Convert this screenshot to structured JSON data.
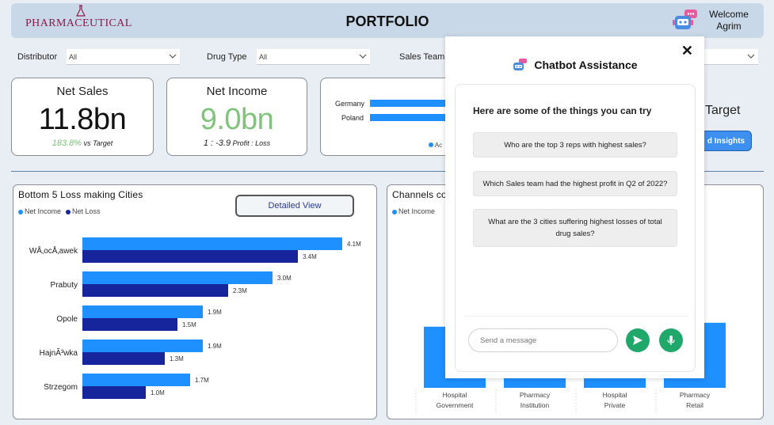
{
  "header": {
    "logo_text": "PHARMACEUTICAL",
    "title": "PORTFOLIO",
    "welcome": "Welcome",
    "user": "Agrim"
  },
  "filters": [
    {
      "label": "Distributor",
      "value": "All"
    },
    {
      "label": "Drug Type",
      "value": "All"
    },
    {
      "label": "Sales Team",
      "value": ""
    }
  ],
  "kpis": {
    "net_sales": {
      "title": "Net Sales",
      "value": "11.8bn",
      "delta": "183.8%",
      "delta_label": "vs Target"
    },
    "net_income": {
      "title": "Net Income",
      "value": "9.0bn",
      "ratio": "1 : -3.9",
      "ratio_label": "Profit : Loss"
    }
  },
  "country_chart": {
    "categories": [
      "Germany",
      "Poland"
    ],
    "legend_fragment": "Ac"
  },
  "target_fragment": "Target",
  "insights_button": "d Insights",
  "loss_cities": {
    "title": "Bottom 5 Loss making Cities",
    "legend": [
      "Net Income",
      "Net Loss"
    ],
    "detail_button": "Detailed View"
  },
  "channels": {
    "title_fragment": "Channels co",
    "legend_fragment": "Net Income",
    "categories": [
      {
        "l1": "Hospital",
        "l2": "Government"
      },
      {
        "l1": "Pharmacy",
        "l2": "Institution"
      },
      {
        "l1": "Hospital",
        "l2": "Private"
      },
      {
        "l1": "Pharmacy",
        "l2": "Retail"
      }
    ]
  },
  "chatbot": {
    "title": "Chatbot Assistance",
    "close": "✕",
    "hint": "Here are some of the things you can try",
    "suggestions": [
      "Who are the top 3 reps with highest sales?",
      "Which Sales team had the highest profit in Q2 of 2022?",
      "What are the 3 cities suffering highest losses of total drug sales?"
    ],
    "input_placeholder": "Send a message"
  },
  "colors": {
    "income": "#1e90ff",
    "loss": "#16259b",
    "green": "#20a86b"
  },
  "chart_data": [
    {
      "type": "bar",
      "orientation": "horizontal",
      "title": "Bottom 5 Loss making Cities",
      "categories": [
        "WÅ‚ocÅ‚awek",
        "Prabuty",
        "Opole",
        "HajnÃ³wka",
        "Strzegom"
      ],
      "series": [
        {
          "name": "Net Income",
          "values": [
            4.1,
            3.0,
            1.9,
            1.9,
            1.7
          ]
        },
        {
          "name": "Net Loss",
          "values": [
            3.4,
            2.3,
            1.5,
            1.3,
            1.0
          ]
        }
      ],
      "data_labels": {
        "Net Income": [
          "4.1M",
          "3.0M",
          "1.9M",
          "1.9M",
          "1.7M"
        ],
        "Net Loss": [
          "3.4M",
          "2.3M",
          "1.5M",
          "1.3M",
          "1.0M"
        ]
      },
      "xlim": [
        0,
        4.2
      ]
    },
    {
      "type": "bar",
      "title": "Channels co",
      "categories": [
        "Hospital Government",
        "Pharmacy Institution",
        "Hospital Private",
        "Pharmacy Retail"
      ],
      "series": [
        {
          "name": "Net Income",
          "values": [
            0.78,
            0.8,
            0.8,
            0.83
          ]
        }
      ]
    }
  ]
}
